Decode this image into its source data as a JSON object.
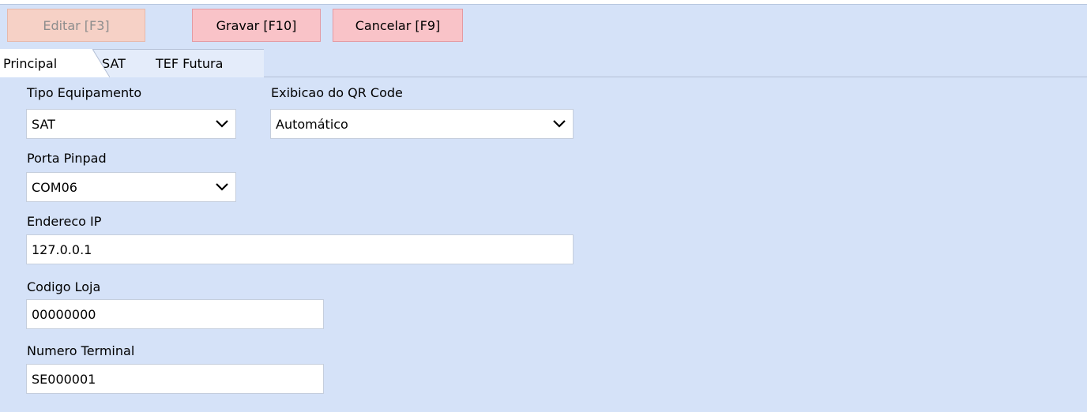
{
  "toolbar": {
    "editar_label": "Editar [F3]",
    "gravar_label": "Gravar [F10]",
    "cancelar_label": "Cancelar [F9]"
  },
  "tabs": [
    {
      "label": "Principal"
    },
    {
      "label": "SAT"
    },
    {
      "label": "TEF Futura"
    }
  ],
  "form": {
    "tipo_equipamento": {
      "label": "Tipo Equipamento",
      "value": "SAT"
    },
    "exibicao_qr": {
      "label": "Exibicao do QR Code",
      "value": "Automático"
    },
    "porta_pinpad": {
      "label": "Porta Pinpad",
      "value": "COM06"
    },
    "endereco_ip": {
      "label": "Endereco IP",
      "value": "127.0.0.1"
    },
    "codigo_loja": {
      "label": "Codigo Loja",
      "value": "00000000"
    },
    "numero_terminal": {
      "label": "Numero Terminal",
      "value": "SE000001"
    }
  },
  "icons": {
    "dropdown": "chevron-down-icon"
  }
}
